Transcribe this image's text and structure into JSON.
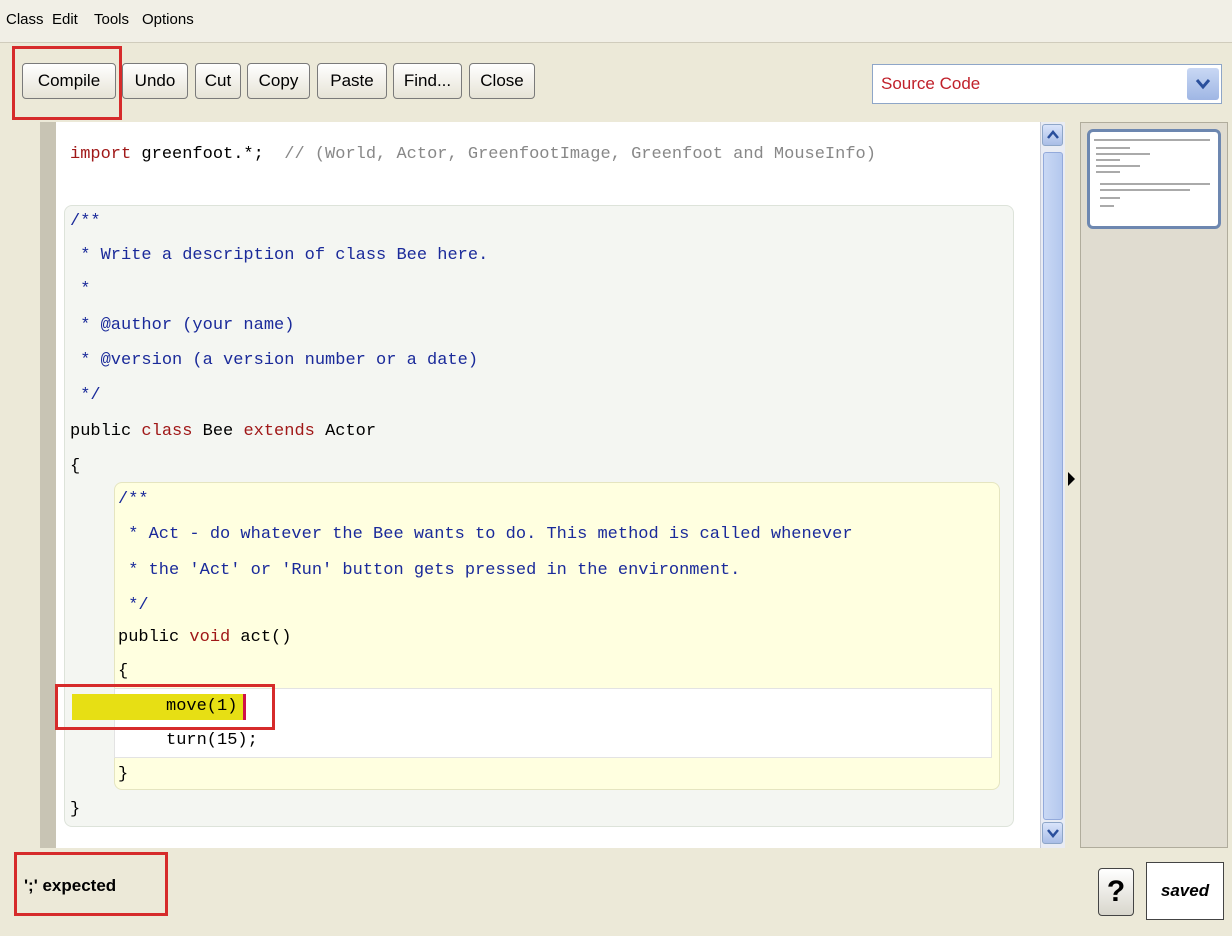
{
  "menu": {
    "class": "Class",
    "edit": "Edit",
    "tools": "Tools",
    "options": "Options"
  },
  "toolbar": {
    "compile": "Compile",
    "undo": "Undo",
    "cut": "Cut",
    "copy": "Copy",
    "paste": "Paste",
    "find": "Find...",
    "close": "Close",
    "view_select": "Source Code"
  },
  "code": {
    "import_kw": "import",
    "import_rest": " greenfoot.*;",
    "import_comment": "  // (World, Actor, GreenfootImage, Greenfoot and MouseInfo)",
    "doc1": "/**",
    "doc2": " * Write a description of class Bee here.",
    "doc3": " *",
    "doc4": " * @author (your name)",
    "doc5": " * @version (a version number or a date)",
    "doc6": " */",
    "class_public": "public ",
    "class_kw": "class",
    "class_name": " Bee ",
    "extends_kw": "extends",
    "class_parent": " Actor",
    "open_brace": "{",
    "mdoc1": "/**",
    "mdoc2": " * Act - do whatever the Bee wants to do. This method is called whenever",
    "mdoc3": " * the 'Act' or 'Run' button gets pressed in the environment.",
    "mdoc4": " */",
    "method_public": "public ",
    "method_void": "void",
    "method_rest": " act()",
    "method_open": "{",
    "line_move": "move(1)",
    "line_turn": "turn(15);",
    "method_close": "}",
    "close_brace": "}"
  },
  "status": {
    "message": "';' expected",
    "help": "?",
    "saved": "saved"
  },
  "colors": {
    "keyword": "#a01818",
    "comment": "#1a2a9a",
    "highlight": "#d62b2b",
    "error_line": "#e7df14"
  }
}
